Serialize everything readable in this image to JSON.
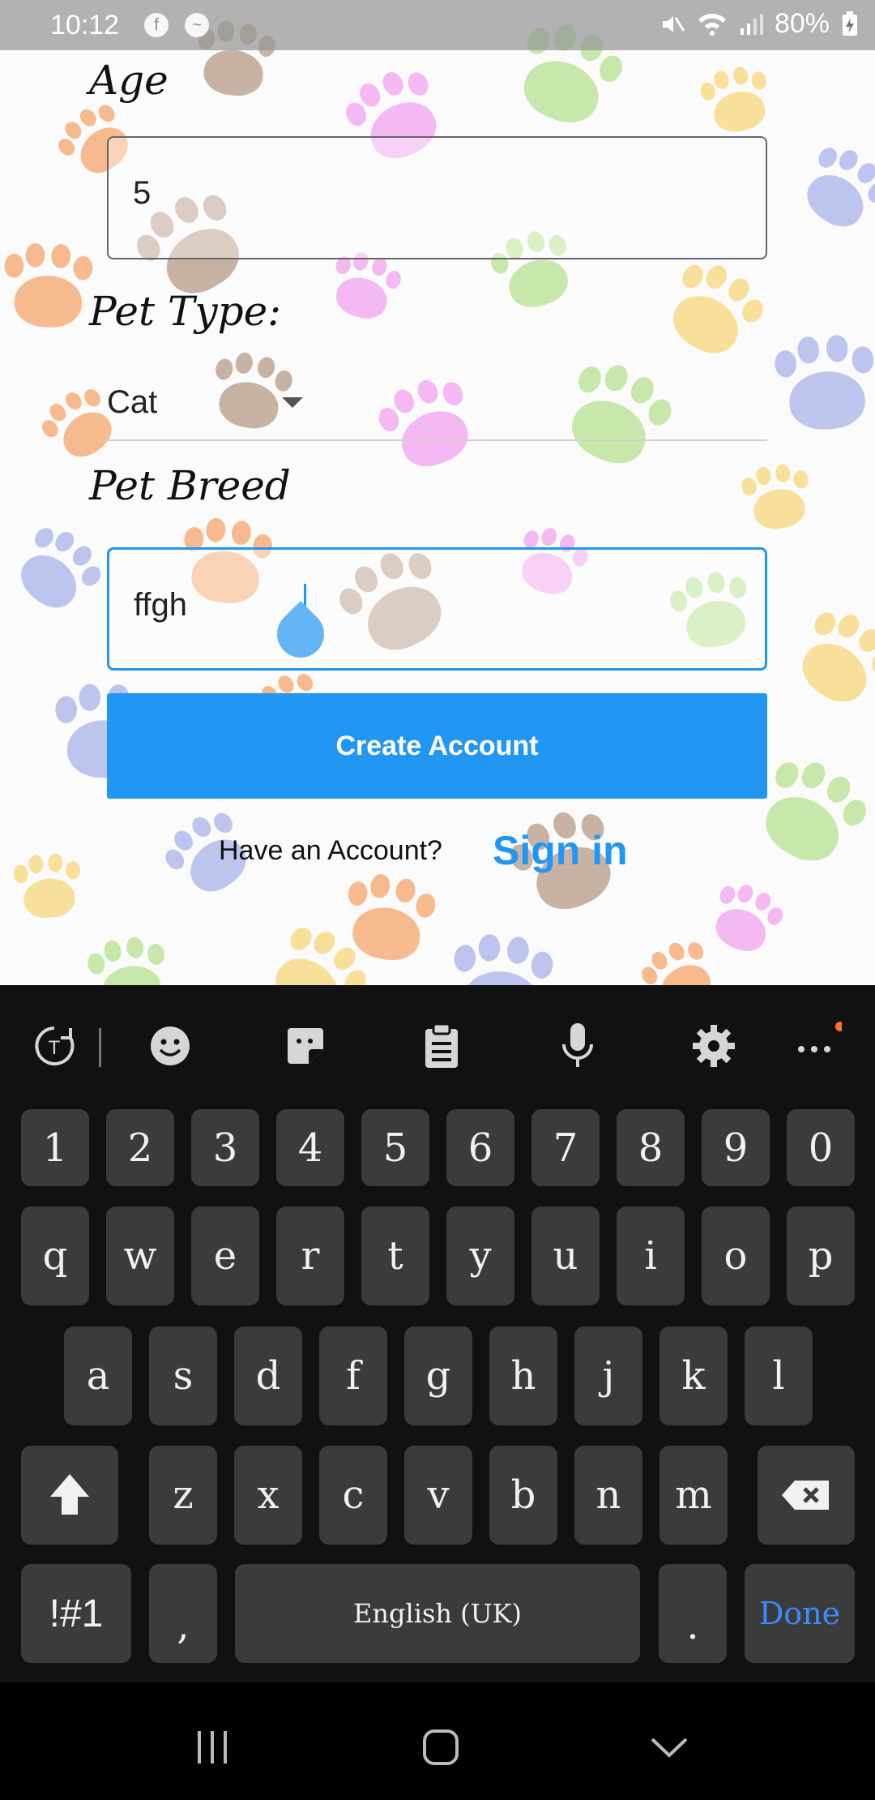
{
  "status_bar": {
    "time": "10:12",
    "battery": "80%",
    "battery_icon": "battery-charging-icon"
  },
  "form": {
    "age_label": "Age",
    "age_value": "5",
    "pet_type_label": "Pet Type:",
    "pet_type_value": "Cat",
    "pet_breed_label": "Pet Breed",
    "pet_breed_value": "ffgh",
    "create_account_label": "Create Account",
    "have_account_text": "Have an Account?",
    "sign_in_label": "Sign in"
  },
  "colors": {
    "accent": "#2196f3",
    "keyboard_bg": "#111111",
    "key_bg": "#3b3b3b",
    "done_text": "#3a8dff"
  },
  "keyboard": {
    "toolbar_icons": [
      "translate-icon",
      "emoji-icon",
      "sticker-icon",
      "clipboard-icon",
      "microphone-icon",
      "gear-icon",
      "more-icon"
    ],
    "row_numbers": [
      "1",
      "2",
      "3",
      "4",
      "5",
      "6",
      "7",
      "8",
      "9",
      "0"
    ],
    "row_1": [
      "q",
      "w",
      "e",
      "r",
      "t",
      "y",
      "u",
      "i",
      "o",
      "p"
    ],
    "row_2": [
      "a",
      "s",
      "d",
      "f",
      "g",
      "h",
      "j",
      "k",
      "l"
    ],
    "row_3": [
      "z",
      "x",
      "c",
      "v",
      "b",
      "n",
      "m"
    ],
    "symbols_label": "!#1",
    "comma_label": ",",
    "space_label": "English (UK)",
    "period_label": ".",
    "done_label": "Done"
  },
  "nav_bar": {
    "icons": [
      "recents-icon",
      "home-icon",
      "back-icon"
    ]
  }
}
